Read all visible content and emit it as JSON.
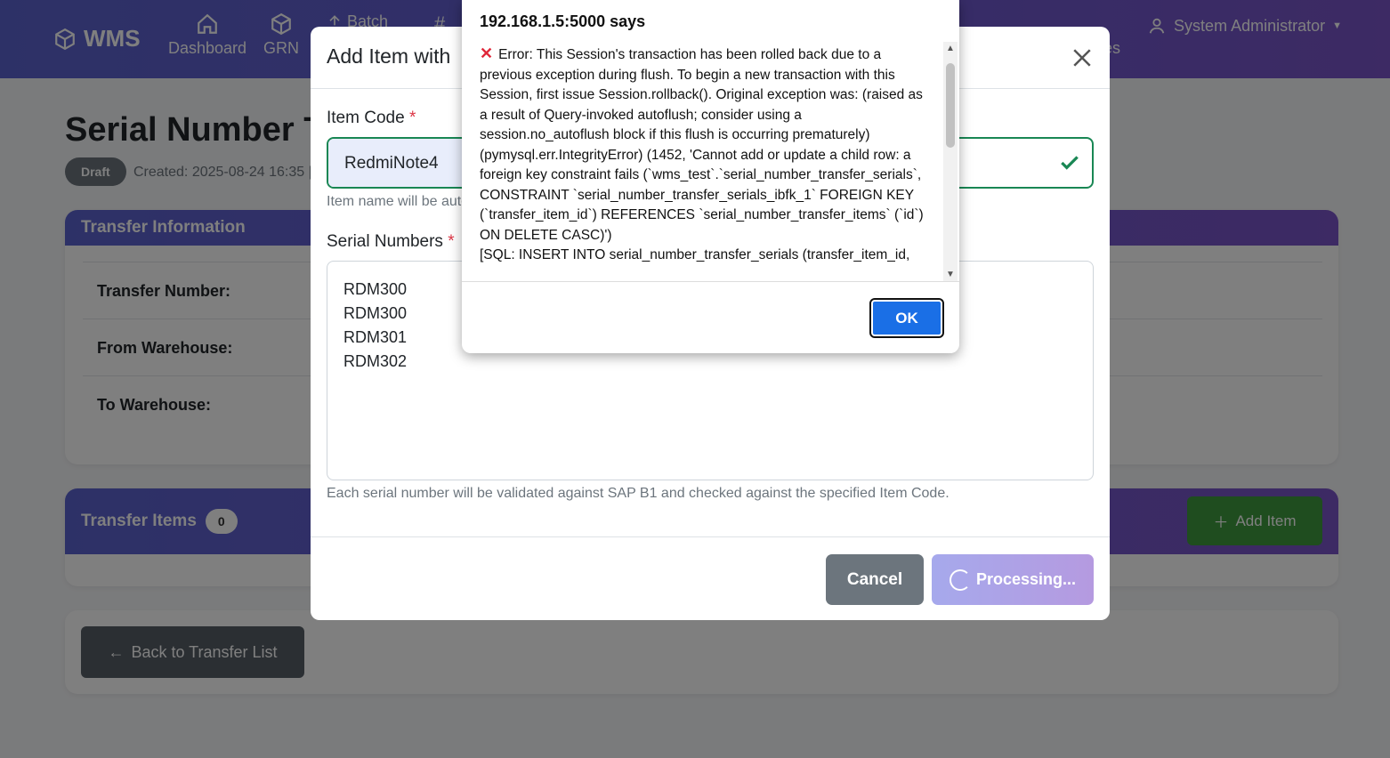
{
  "navbar": {
    "brand": "WMS",
    "items": [
      {
        "label": "Dashboard",
        "icon": "home-icon"
      },
      {
        "label": "GRN",
        "icon": "box-icon"
      },
      {
        "label": "Batch",
        "icon": "upload-icon"
      },
      {
        "label": "#",
        "icon": "hash-icon"
      }
    ],
    "partial_right": "es",
    "user": "System Administrator"
  },
  "page": {
    "title": "Serial Number Tr",
    "status": "Draft",
    "created": "Created: 2025-08-24 16:35 | U"
  },
  "transfer_info": {
    "header": "Transfer Information",
    "rows": [
      {
        "label": "Transfer Number:"
      },
      {
        "label": "From Warehouse:"
      },
      {
        "label": "To Warehouse:"
      }
    ]
  },
  "transfer_items": {
    "header": "Transfer Items",
    "count": "0",
    "add_button": "Add Item"
  },
  "back_button": "Back to Transfer List",
  "modal": {
    "title": "Add Item with",
    "item_code_label": "Item Code",
    "item_code_value": "RedmiNote4",
    "item_name_help": "Item name will be auto",
    "serials_label": "Serial Numbers",
    "serials_value": "RDM300\nRDM300\nRDM301\nRDM302",
    "serials_help": "Each serial number will be validated against SAP B1 and checked against the specified Item Code.",
    "cancel": "Cancel",
    "processing": "Processing..."
  },
  "alert": {
    "title": "192.168.1.5:5000 says",
    "message": "Error: This Session's transaction has been rolled back due to a previous exception during flush. To begin a new transaction with this Session, first issue Session.rollback(). Original exception was: (raised as a result of Query-invoked autoflush; consider using a session.no_autoflush block if this flush is occurring prematurely) (pymysql.err.IntegrityError) (1452, 'Cannot add or update a child row: a foreign key constraint fails (`wms_test`.`serial_number_transfer_serials`, CONSTRAINT `serial_number_transfer_serials_ibfk_1` FOREIGN KEY (`transfer_item_id`) REFERENCES `serial_number_transfer_items` (`id`) ON DELETE CASC)')\n[SQL: INSERT INTO serial_number_transfer_serials (transfer_item_id,",
    "ok": "OK"
  },
  "colors": {
    "navbar": "#5b63cf",
    "success": "#198754",
    "danger": "#dc3545",
    "ok_button": "#1a6fe6"
  }
}
